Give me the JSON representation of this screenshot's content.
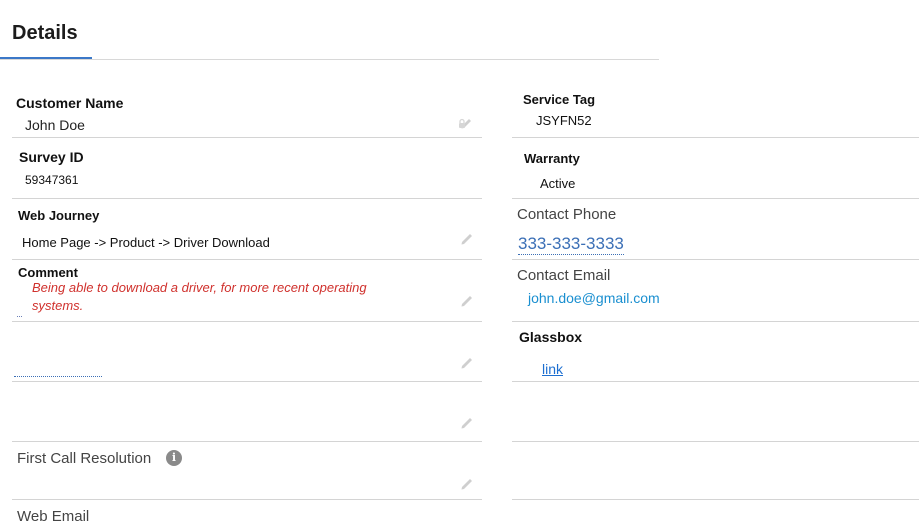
{
  "tab": {
    "title": "Details"
  },
  "left": {
    "customer_name": {
      "label": "Customer Name",
      "value": "John Doe"
    },
    "survey_id": {
      "label": "Survey ID",
      "value": "59347361"
    },
    "web_journey": {
      "label": "Web Journey",
      "value": "Home Page -> Product -> Driver Download"
    },
    "comment": {
      "label": "Comment",
      "line1": "Being able to download a driver, for more recent operating",
      "line2": "systems."
    },
    "first_call_resolution": {
      "label": "First Call Resolution",
      "info_glyph": "i"
    },
    "web_email": {
      "label": "Web Email"
    }
  },
  "right": {
    "service_tag": {
      "label": "Service Tag",
      "value": "JSYFN52"
    },
    "warranty": {
      "label": "Warranty",
      "value": "Active"
    },
    "contact_phone": {
      "label": "Contact Phone",
      "value": "333-333-3333"
    },
    "contact_email": {
      "label": "Contact Email",
      "value": "john.doe@gmail.com"
    },
    "glassbox": {
      "label": "Glassbox",
      "link": "link"
    }
  },
  "colors": {
    "accent": "#3b78c8",
    "comment_text": "#d0312d",
    "phone_link": "#3b6fb6",
    "email_link": "#1a8fd0",
    "glassbox_link": "#1d6fd1"
  },
  "icons": {
    "edit": "pencil-icon",
    "locked_edit": "lock-pencil-icon",
    "info": "info-icon"
  }
}
